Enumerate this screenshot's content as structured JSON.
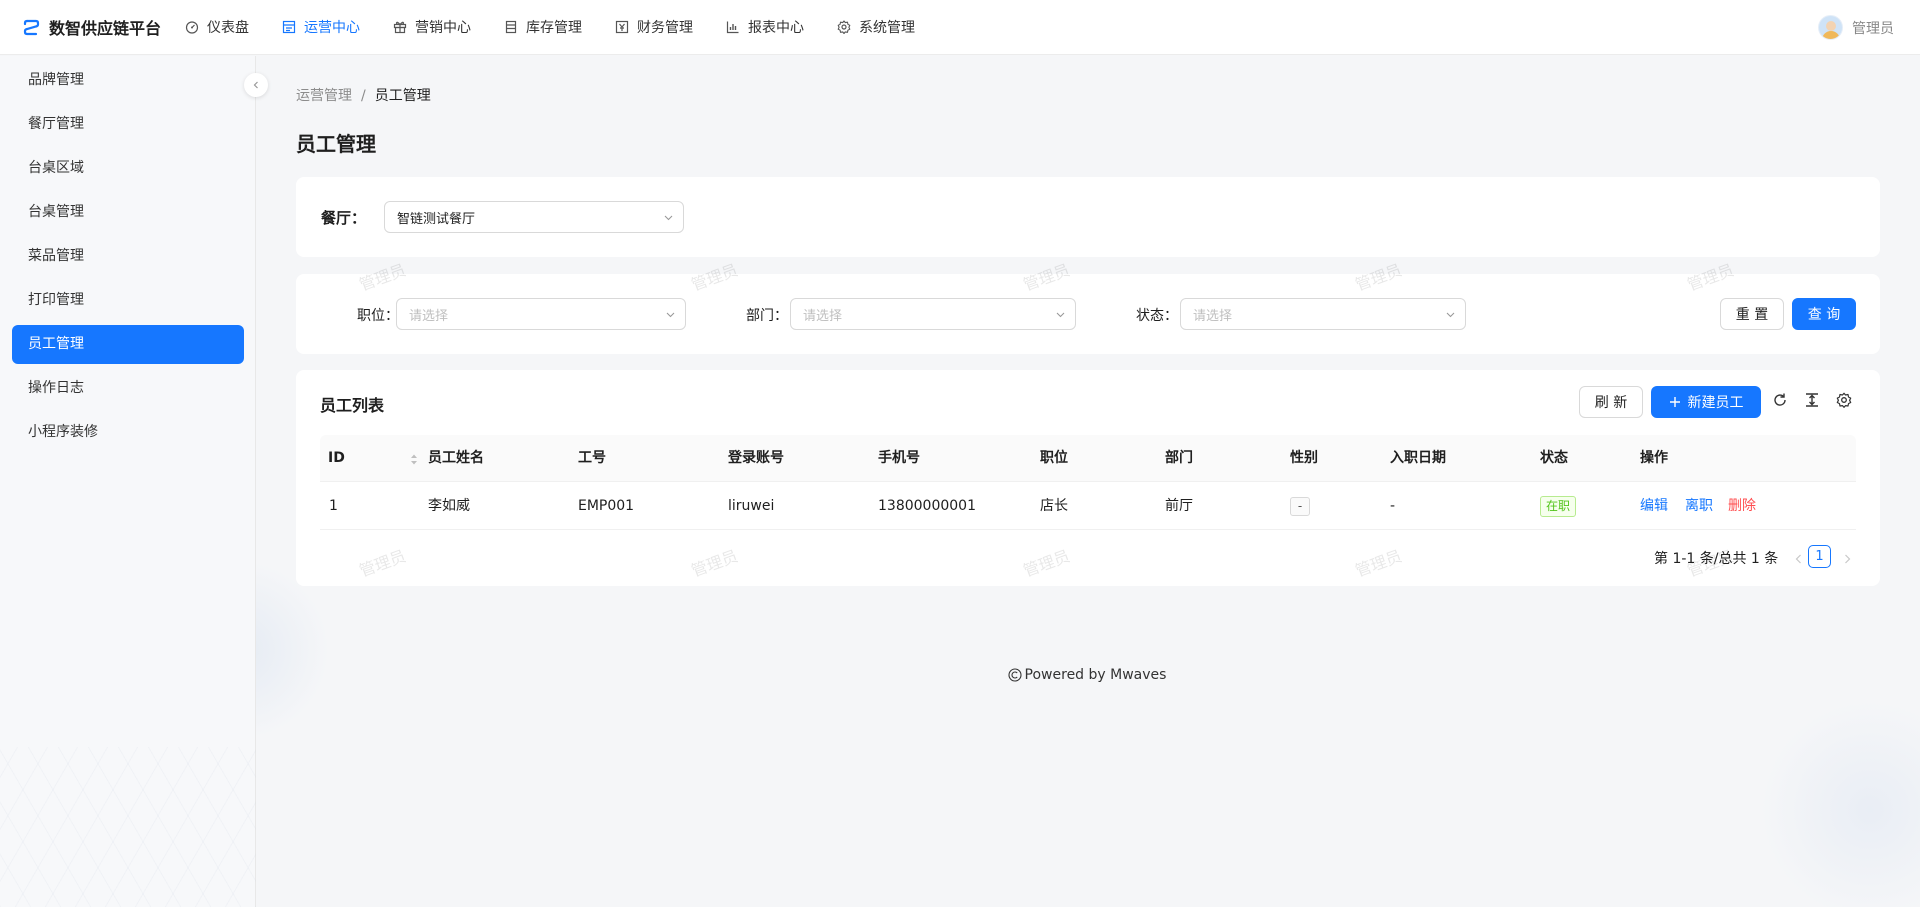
{
  "app": {
    "title": "数智供应链平台"
  },
  "topnav": [
    {
      "label": "仪表盘",
      "icon": "dashboard-icon",
      "active": false
    },
    {
      "label": "运营中心",
      "icon": "operations-icon",
      "active": true
    },
    {
      "label": "营销中心",
      "icon": "gift-icon",
      "active": false
    },
    {
      "label": "库存管理",
      "icon": "inventory-icon",
      "active": false
    },
    {
      "label": "财务管理",
      "icon": "finance-icon",
      "active": false
    },
    {
      "label": "报表中心",
      "icon": "chart-icon",
      "active": false
    },
    {
      "label": "系统管理",
      "icon": "gear-icon",
      "active": false
    }
  ],
  "user": {
    "name": "管理员"
  },
  "sidebar": {
    "items": [
      {
        "label": "品牌管理"
      },
      {
        "label": "餐厅管理"
      },
      {
        "label": "台桌区域"
      },
      {
        "label": "台桌管理"
      },
      {
        "label": "菜品管理"
      },
      {
        "label": "打印管理"
      },
      {
        "label": "员工管理",
        "active": true
      },
      {
        "label": "操作日志"
      },
      {
        "label": "小程序装修"
      }
    ]
  },
  "breadcrumb": {
    "parent": "运营管理",
    "separator": "/",
    "current": "员工管理"
  },
  "page_title": "员工管理",
  "restaurant_filter": {
    "label": "餐厅：",
    "value": "智链测试餐厅"
  },
  "filters": {
    "position": {
      "label": "职位：",
      "placeholder": "请选择"
    },
    "department": {
      "label": "部门：",
      "placeholder": "请选择"
    },
    "status": {
      "label": "状态：",
      "placeholder": "请选择"
    },
    "reset_label": "重 置",
    "query_label": "查 询"
  },
  "table": {
    "title": "员工列表",
    "refresh_label": "刷 新",
    "new_label": "新建员工",
    "columns": [
      "ID",
      "员工姓名",
      "工号",
      "登录账号",
      "手机号",
      "职位",
      "部门",
      "性别",
      "入职日期",
      "状态",
      "操作"
    ],
    "rows": [
      {
        "id": "1",
        "name": "李如威",
        "emp_no": "EMP001",
        "account": "liruwei",
        "phone": "13800000001",
        "position": "店长",
        "department": "前厅",
        "gender": "-",
        "hire_date": "-",
        "status": "在职"
      }
    ],
    "actions": {
      "edit": "编辑",
      "resign": "离职",
      "delete": "删除"
    }
  },
  "pagination": {
    "total_text": "第 1-1 条/总共 1 条",
    "current_page": "1"
  },
  "footer": {
    "text": "Powered by Mwaves"
  },
  "watermark": {
    "text": "管理员"
  },
  "colors": {
    "primary": "#1677ff",
    "danger": "#ff4d4f",
    "success": "#52c41a"
  }
}
